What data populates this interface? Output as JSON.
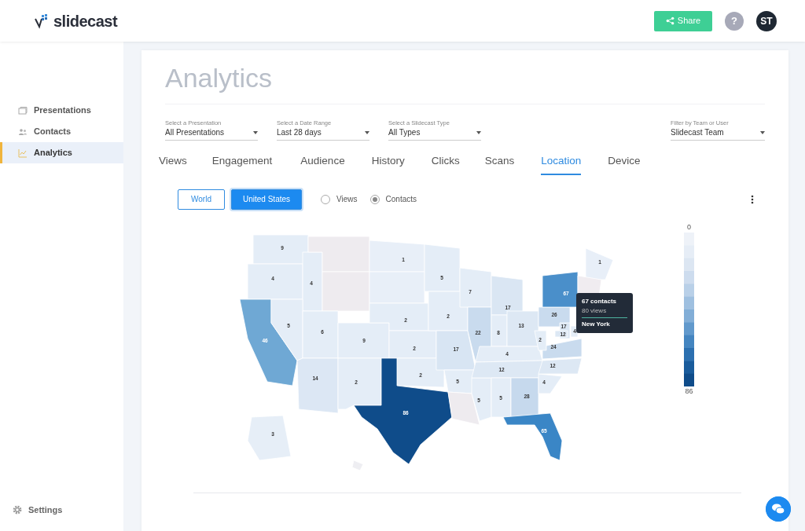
{
  "header": {
    "logo": "slidecast",
    "share_button": "Share",
    "help_button": "?",
    "avatar": "ST"
  },
  "sidebar": {
    "items": [
      {
        "label": "Presentations",
        "selected": false
      },
      {
        "label": "Contacts",
        "selected": false
      },
      {
        "label": "Analytics",
        "selected": true
      }
    ],
    "footer_item": {
      "label": "Settings"
    }
  },
  "page_title": "Analytics",
  "filters": [
    {
      "label": "Select a Presentation",
      "value": "All Presentations"
    },
    {
      "label": "Select a Date Range",
      "value": "Last 28 days"
    },
    {
      "label": "Select a Slidecast Type",
      "value": "All Types"
    },
    {
      "label": "Filter by Team or User",
      "value": "Slidecast Team"
    }
  ],
  "tabs": [
    {
      "label": "Views",
      "selected": false
    },
    {
      "label": "Engagement",
      "selected": false
    },
    {
      "label": "Audience",
      "selected": false
    },
    {
      "label": "History",
      "selected": false
    },
    {
      "label": "Clicks",
      "selected": false
    },
    {
      "label": "Scans",
      "selected": false
    },
    {
      "label": "Location",
      "selected": true
    },
    {
      "label": "Device",
      "selected": false
    }
  ],
  "region_toggle": [
    {
      "label": "World",
      "selected": false
    },
    {
      "label": "United States",
      "selected": true
    }
  ],
  "metric_radios": [
    {
      "label": "Views",
      "checked": false
    },
    {
      "label": "Contacts",
      "checked": true
    }
  ],
  "map": {
    "states": [
      {
        "label": "9",
        "color": "#e4edf7"
      },
      {
        "label": "4",
        "color": "#e4edf7"
      },
      {
        "label": "46",
        "color": "#6fa8d4"
      },
      {
        "label": "4",
        "color": "#e4edf7"
      },
      {
        "label": "5",
        "color": "#e4edf7"
      },
      {
        "color": "#eeebef"
      },
      {
        "color": "#eeebef"
      },
      {
        "label": "6",
        "color": "#e4edf7"
      },
      {
        "label": "9",
        "color": "#e4edf7"
      },
      {
        "label": "14",
        "color": "#dce7f4"
      },
      {
        "label": "2",
        "color": "#e4edf7"
      },
      {
        "label": "1",
        "color": "#e8eff8"
      },
      {
        "color": "#e8eff8"
      },
      {
        "label": "2",
        "color": "#e4edf7"
      },
      {
        "label": "2",
        "color": "#e4edf7"
      },
      {
        "label": "2",
        "color": "#e4edf7"
      },
      {
        "label": "86",
        "color": "#0f4c8a"
      },
      {
        "label": "5",
        "color": "#e4edf7"
      },
      {
        "label": "2",
        "color": "#e4edf7"
      },
      {
        "label": "17",
        "color": "#d8e5f3"
      },
      {
        "label": "5",
        "color": "#e4edf7"
      },
      {
        "color": "#eeebef"
      },
      {
        "label": "7",
        "color": "#e4edf7"
      },
      {
        "label": "22",
        "color": "#c9dbee"
      },
      {
        "label": "5",
        "color": "#e4edf7"
      },
      {
        "label": "17",
        "color": "#dae6f3"
      },
      {
        "label": "8",
        "color": "#e4edf7"
      },
      {
        "label": "13",
        "color": "#dde8f4"
      },
      {
        "label": "4",
        "color": "#e4edf7"
      },
      {
        "label": "12",
        "color": "#dde8f4"
      },
      {
        "label": "5",
        "color": "#e4edf7"
      },
      {
        "label": "28",
        "color": "#c6d9ed"
      },
      {
        "label": "4",
        "color": "#e4edf7"
      },
      {
        "label": "24",
        "color": "#c9dbee"
      },
      {
        "label": "12",
        "color": "#dde8f4"
      },
      {
        "label": "2",
        "color": "#e4edf7"
      },
      {
        "label": "26",
        "color": "#c9dbee"
      },
      {
        "label": "67",
        "color": "#4a8fca"
      },
      {
        "label": "17",
        "color": "#dae6f3"
      },
      {
        "label": "12",
        "color": "#dde8f4"
      },
      {
        "label": "4",
        "color": "#e4edf7"
      },
      {
        "label": "1",
        "color": "#e8eff8"
      },
      {
        "color": "#f0ecf0"
      },
      {
        "label": "65",
        "color": "#3a86c6"
      },
      {
        "label": "3",
        "color": "#e6eef7"
      },
      {
        "color": "#eeeef2"
      }
    ],
    "tooltip": {
      "contacts": "67 contacts",
      "views": "80 views",
      "state": "New York"
    },
    "legend": {
      "min": "0",
      "max": "86"
    }
  }
}
